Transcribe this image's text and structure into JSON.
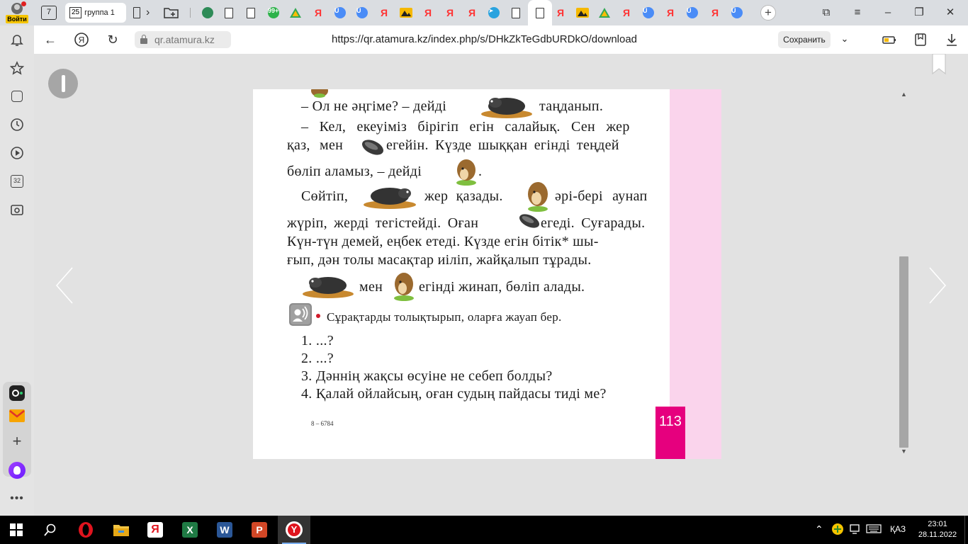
{
  "browser": {
    "profile_button_label": "Войти",
    "pinned_tab_number": "7",
    "group_tab": {
      "count": "25",
      "label": "группа 1"
    },
    "tab_icons": [
      "globe-icon",
      "document-icon",
      "document-icon",
      "counter-icon",
      "drive-icon",
      "yandex-icon",
      "u-icon",
      "u-icon",
      "yandex-icon",
      "yandex-icon",
      "yandex-icon",
      "yandex-icon",
      "yandex-icon",
      "telegram-icon",
      "document-icon",
      "yandex-icon",
      "yandex-icon",
      "drive-icon",
      "yandex-icon",
      "u-icon",
      "yandex-icon",
      "u-icon",
      "yandex-icon",
      "u-icon"
    ],
    "tab_counter_badge": "99+",
    "new_tab_label": "+",
    "address": {
      "domain": "qr.atamura.kz",
      "url": "https://qr.atamura.kz/index.php/s/DHkZkTeGdbURDkO/download",
      "save_label": "Сохранить"
    },
    "sidebar_badge": "32"
  },
  "book_page": {
    "lines": [
      "– Ол не әңгіме? – дейді",
      "таңданып.",
      "– Кел, екеуіміз бірігіп егін салайық. Сен жер",
      "қаз, мен",
      "егейін. Күзде шыққан егінді теңдей",
      "бөліп аламыз, – дейді",
      ".",
      "Сөйтіп,",
      "жер қазады.",
      "әрі-бері аунап",
      "жүріп, жерді тегістейді. Оған",
      "егеді. Суғарады.",
      "Күн-түн демей, еңбек етеді. Күзде егін бітік* шы-",
      "ғып, дән толы масақтар иіліп, жайқалып тұрады.",
      "мен",
      "егінді жинап, бөліп алады."
    ],
    "task_instruction": "Сұрақтарды толықтырып, оларға жауап бер.",
    "questions": [
      "1. ...?",
      "2. ...?",
      "3. Дәннің жақсы өсуіне не себеп болды?",
      "4. Қалай ойлайсың, оған судың пайдасы тиді ме?"
    ],
    "footer_code": "8 – 6784",
    "page_number": "113",
    "accent_color": "#e6007e",
    "strip_color": "#fad4ec"
  },
  "taskbar": {
    "language": "ҚАЗ",
    "time": "23:01",
    "date": "28.11.2022",
    "apps": [
      "opera-icon",
      "file-explorer-icon",
      "yandex-app-icon",
      "excel-icon",
      "word-icon",
      "powerpoint-icon",
      "yandex-browser-icon"
    ]
  }
}
